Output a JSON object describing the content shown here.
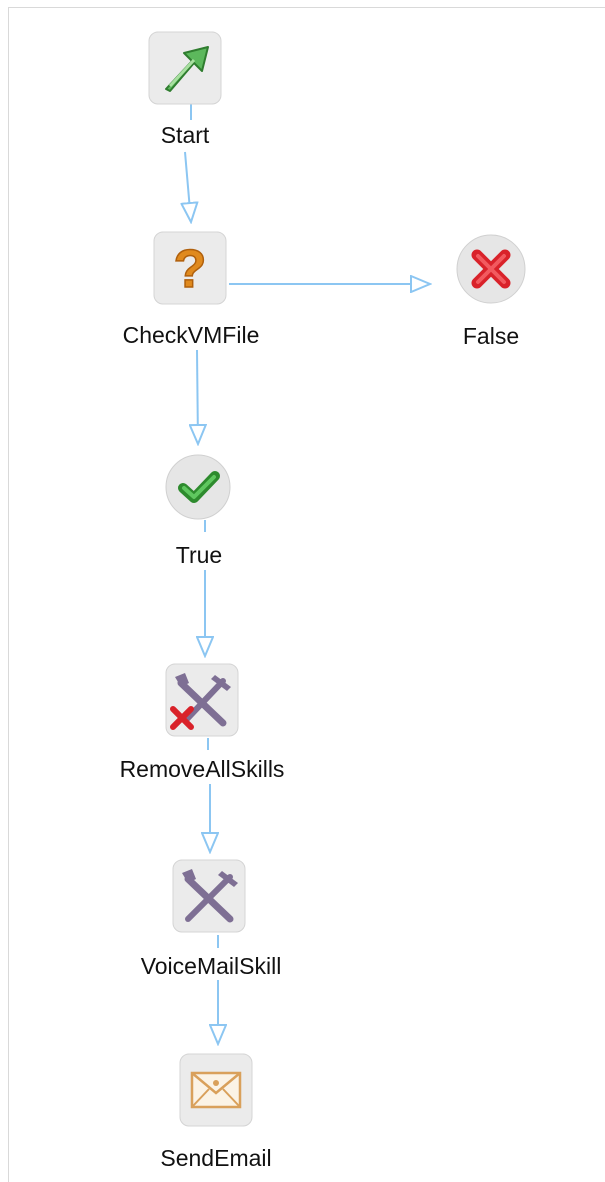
{
  "diagram": {
    "title": "",
    "nodes": [
      {
        "id": "start",
        "label": "Start",
        "icon": "start-arrow-icon"
      },
      {
        "id": "checkvmfile",
        "label": "CheckVMFile",
        "icon": "question-mark-icon"
      },
      {
        "id": "false",
        "label": "False",
        "icon": "red-x-icon"
      },
      {
        "id": "true",
        "label": "True",
        "icon": "green-check-icon"
      },
      {
        "id": "removeallskills",
        "label": "RemoveAllSkills",
        "icon": "tools-remove-icon"
      },
      {
        "id": "voicemailskill",
        "label": "VoiceMailSkill",
        "icon": "tools-icon"
      },
      {
        "id": "sendemail",
        "label": "SendEmail",
        "icon": "envelope-icon"
      }
    ],
    "edges": [
      {
        "from": "start",
        "to": "checkvmfile"
      },
      {
        "from": "checkvmfile",
        "to": "false"
      },
      {
        "from": "checkvmfile",
        "to": "true"
      },
      {
        "from": "true",
        "to": "removeallskills"
      },
      {
        "from": "removeallskills",
        "to": "voicemailskill"
      },
      {
        "from": "voicemailskill",
        "to": "sendemail"
      }
    ],
    "colors": {
      "connector": "#8cc6f2",
      "tile_bg": "#ebebeb",
      "start_arrow": "#5cb85c",
      "question": "#e08a1e",
      "false_x": "#d9222a",
      "true_check": "#3aa63a",
      "tools": "#7e6f94",
      "envelope": "#d9a05b"
    }
  }
}
